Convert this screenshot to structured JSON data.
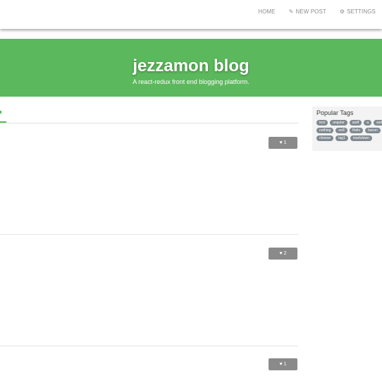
{
  "nav": {
    "home": "HOME",
    "new_post": "NEW POST",
    "settings": "SETTINGS",
    "new_post_icon": "compose-icon",
    "settings_icon": "gear-icon"
  },
  "banner": {
    "title": "jezzamon blog",
    "subtitle": "A react-redux front end blogging platform."
  },
  "articles": [
    {
      "likes": "1"
    },
    {
      "likes": "2"
    },
    {
      "likes": "1"
    }
  ],
  "sidebar": {
    "title": "Popular Tags",
    "tags": [
      "test",
      "angular",
      "asdf",
      "a",
      "asd",
      "nothing",
      "ee8",
      "Hello",
      "bacon",
      "stuff",
      "cheese",
      "tag1",
      "markdown"
    ]
  },
  "colors": {
    "brand": "#5cb85c",
    "tag_bg": "#818a91",
    "like_button": "#8a8a8a"
  }
}
